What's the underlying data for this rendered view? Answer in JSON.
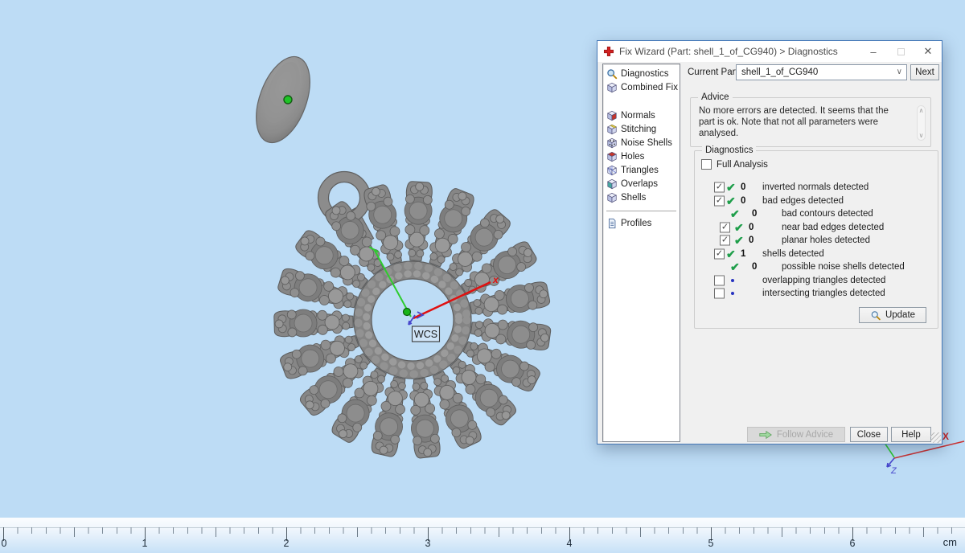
{
  "window": {
    "title": "Fix Wizard (Part: shell_1_of_CG940) > Diagnostics"
  },
  "sidebar": {
    "top_items": [
      {
        "label": "Diagnostics"
      },
      {
        "label": "Combined Fix"
      }
    ],
    "tool_items": [
      {
        "label": "Normals"
      },
      {
        "label": "Stitching"
      },
      {
        "label": "Noise Shells"
      },
      {
        "label": "Holes"
      },
      {
        "label": "Triangles"
      },
      {
        "label": "Overlaps"
      },
      {
        "label": "Shells"
      }
    ],
    "profiles_label": "Profiles"
  },
  "current_part": {
    "label": "Current Part:",
    "value": "shell_1_of_CG940",
    "next_label": "Next"
  },
  "advice": {
    "title": "Advice",
    "text": "No more errors are detected. It seems that the part is ok. Note that not all parameters were analysed."
  },
  "diagnostics": {
    "title": "Diagnostics",
    "full_analysis_label": "Full Analysis",
    "rows": [
      {
        "count": "0",
        "label": "inverted normals detected"
      },
      {
        "count": "0",
        "label": "bad edges detected"
      },
      {
        "count": "0",
        "label": "bad contours detected"
      },
      {
        "count": "0",
        "label": "near bad edges detected"
      },
      {
        "count": "0",
        "label": "planar holes detected"
      },
      {
        "count": "1",
        "label": "shells detected"
      },
      {
        "count": "0",
        "label": "possible noise shells detected"
      },
      {
        "count": "",
        "label": "overlapping triangles detected"
      },
      {
        "count": "",
        "label": "intersecting triangles detected"
      }
    ],
    "update_label": "Update"
  },
  "footer": {
    "follow_advice_label": "Follow Advice",
    "close_label": "Close",
    "help_label": "Help"
  },
  "viewport": {
    "wcs_label": "WCS",
    "axis_x_label": "x",
    "corner_axis_x_label": "X",
    "corner_axis_z_label": "Z",
    "ruler": {
      "unit": "cm",
      "labels": [
        "0",
        "1",
        "2",
        "3",
        "4",
        "5",
        "6"
      ]
    }
  },
  "icons": [
    "fix-wizard-cross-icon",
    "magnifier-icon",
    "cube-icon",
    "document-icon",
    "green-check-icon",
    "blue-dot-icon",
    "green-arrow-icon",
    "chevron-down-icon",
    "minimize-icon",
    "maximize-icon",
    "close-icon"
  ],
  "colors": {
    "viewport_bg": "#bddcf5",
    "check_green": "#1e9e4a",
    "cross_red": "#d42020",
    "axis_green": "#2ecc2e",
    "axis_red": "#dd1b1b",
    "axis_blue": "#4747cc",
    "model_gray": "#878787"
  }
}
